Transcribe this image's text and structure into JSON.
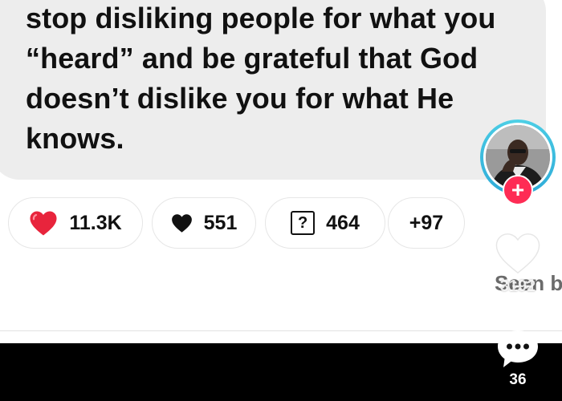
{
  "message": {
    "lines": [
      "stop disliking people for what you",
      "“heard” and be grateful that God",
      "doesn’t dislike you for what He",
      "knows."
    ]
  },
  "reactions": [
    {
      "icon": "red-heart-icon",
      "count": "11.3K"
    },
    {
      "icon": "black-heart-icon",
      "count": "551"
    },
    {
      "icon": "question-box-icon",
      "glyph": "?",
      "count": "464"
    },
    {
      "label": "+97"
    }
  ],
  "seen": {
    "label": "Seen b"
  },
  "side_actions": {
    "follow_icon": "plus-icon",
    "like_count": "3192",
    "comment_count": "36"
  },
  "colors": {
    "bubble": "#ededed",
    "follow": "#fe2c55",
    "red_heart": "#e8243c",
    "avatar_ring": "#2aa6d6"
  }
}
